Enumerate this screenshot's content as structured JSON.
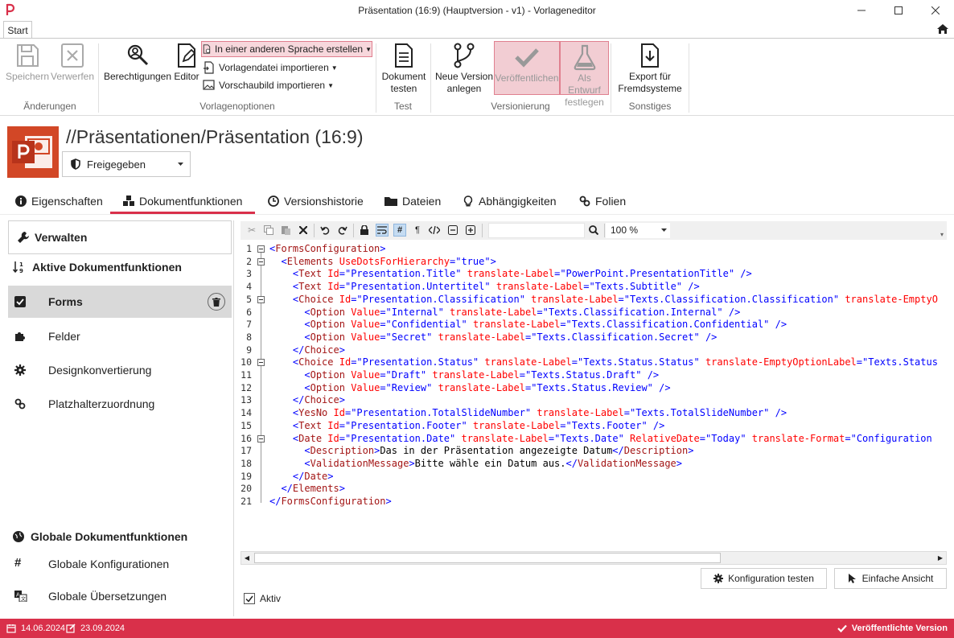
{
  "window": {
    "title": "Präsentation (16:9) (Hauptversion - v1) - Vorlageneditor"
  },
  "tabs": {
    "start": "Start"
  },
  "ribbon": {
    "save": "Speichern",
    "discard": "Verwerfen",
    "group_changes": "Änderungen",
    "permissions": "Berechtigungen",
    "editor": "Editor",
    "create_other_language": "In einer anderen Sprache erstellen",
    "import_template": "Vorlagendatei importieren",
    "import_preview": "Vorschaubild importieren",
    "group_template_options": "Vorlagenoptionen",
    "test_doc_line1": "Dokument",
    "test_doc_line2": "testen",
    "group_test": "Test",
    "new_version_line1": "Neue Version",
    "new_version_line2": "anlegen",
    "publish": "Veröffentlichen",
    "draft_line1": "Als Entwurf",
    "draft_line2": "festlegen",
    "group_versioning": "Versionierung",
    "export_line1": "Export für",
    "export_line2": "Fremdsysteme",
    "group_other": "Sonstiges"
  },
  "header": {
    "breadcrumb": "//Präsentationen/Präsentation (16:9)",
    "status": "Freigegeben"
  },
  "navtabs": {
    "properties": "Eigenschaften",
    "doc_functions": "Dokumentfunktionen",
    "history": "Versionshistorie",
    "files": "Dateien",
    "dependencies": "Abhängigkeiten",
    "slides": "Folien"
  },
  "sidebar": {
    "manage": "Verwalten",
    "active_title": "Aktive Dokumentfunktionen",
    "items": [
      "Forms",
      "Felder",
      "Designkonvertierung",
      "Platzhalterzuordnung"
    ],
    "global_title": "Globale Dokumentfunktionen",
    "global_items": [
      "Globale Konfigurationen",
      "Globale Übersetzungen"
    ]
  },
  "editor": {
    "zoom": "100 %",
    "test_config": "Konfiguration testen",
    "simple_view": "Einfache Ansicht",
    "active_label": "Aktiv",
    "lines": [
      "<FormsConfiguration>",
      "  <Elements UseDotsForHierarchy=\"true\">",
      "    <Text Id=\"Presentation.Title\" translate-Label=\"PowerPoint.PresentationTitle\" />",
      "    <Text Id=\"Presentation.Untertitel\" translate-Label=\"Texts.Subtitle\" />",
      "    <Choice Id=\"Presentation.Classification\" translate-Label=\"Texts.Classification.Classification\" translate-EmptyO",
      "      <Option Value=\"Internal\" translate-Label=\"Texts.Classification.Internal\" />",
      "      <Option Value=\"Confidential\" translate-Label=\"Texts.Classification.Confidential\" />",
      "      <Option Value=\"Secret\" translate-Label=\"Texts.Classification.Secret\" />",
      "    </Choice>",
      "    <Choice Id=\"Presentation.Status\" translate-Label=\"Texts.Status.Status\" translate-EmptyOptionLabel=\"Texts.Status",
      "      <Option Value=\"Draft\" translate-Label=\"Texts.Status.Draft\" />",
      "      <Option Value=\"Review\" translate-Label=\"Texts.Status.Review\" />",
      "    </Choice>",
      "    <YesNo Id=\"Presentation.TotalSlideNumber\" translate-Label=\"Texts.TotalSlideNumber\" />",
      "    <Text Id=\"Presentation.Footer\" translate-Label=\"Texts.Footer\" />",
      "    <Date Id=\"Presentation.Date\" translate-Label=\"Texts.Date\" RelativeDate=\"Today\" translate-Format=\"Configuration",
      "      <Description>Das in der Präsentation angezeigte Datum</Description>",
      "      <ValidationMessage>Bitte wähle ein Datum aus.</ValidationMessage>",
      "    </Date>",
      "  </Elements>",
      "</FormsConfiguration>"
    ],
    "fold_lines": [
      1,
      2,
      5,
      10,
      16
    ]
  },
  "statusbar": {
    "created": "14.06.2024",
    "modified": "23.09.2024",
    "published": "Veröffentlichte Version"
  }
}
